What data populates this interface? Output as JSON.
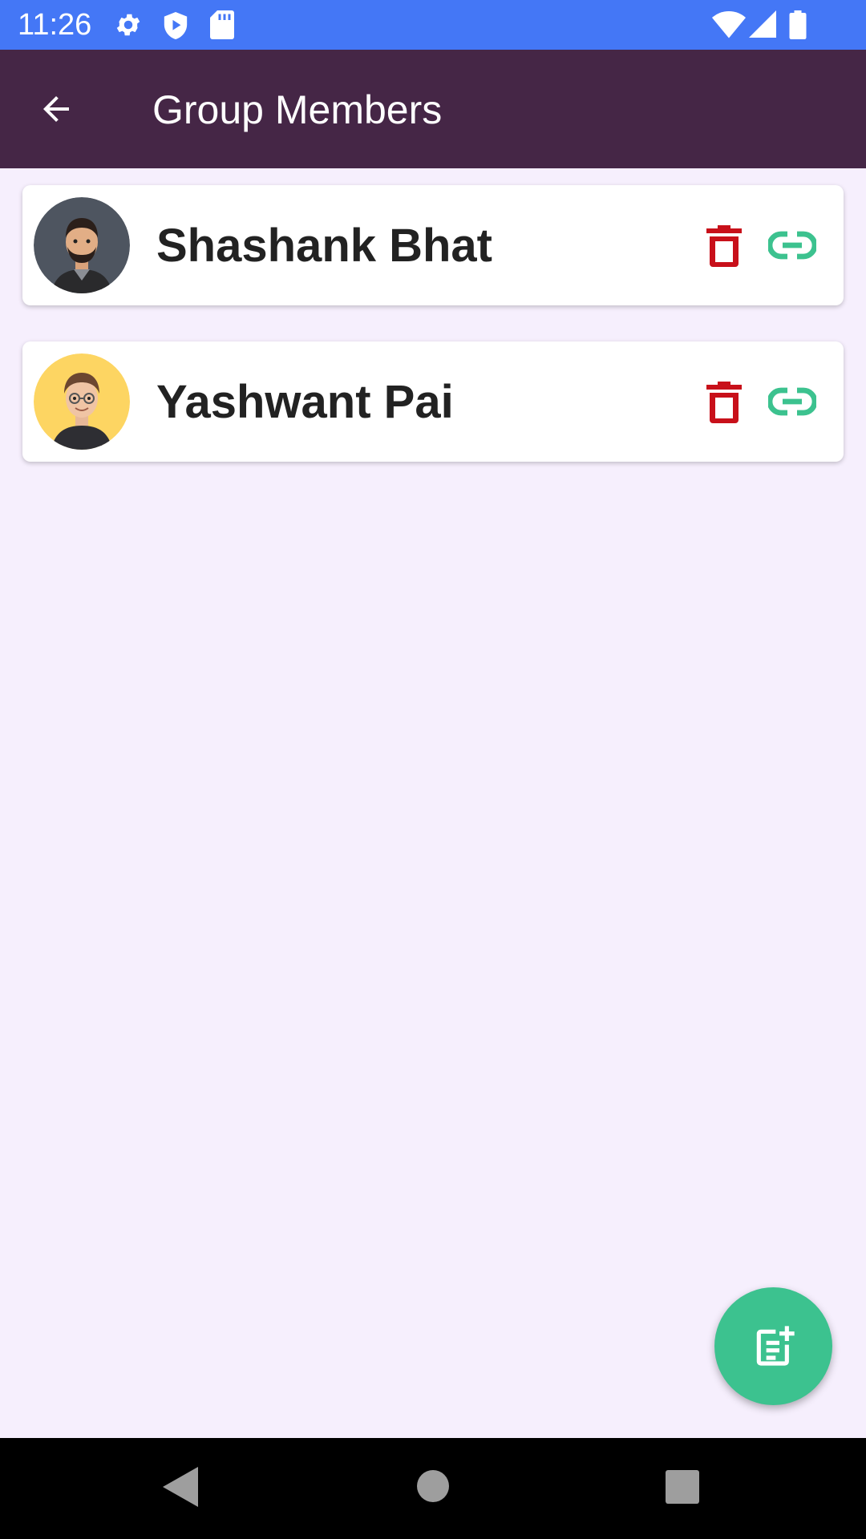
{
  "status_bar": {
    "time": "11:26",
    "icons": [
      "settings-icon",
      "shield-play-icon",
      "sd-card-icon",
      "wifi-icon",
      "signal-icon",
      "battery-icon"
    ]
  },
  "app_bar": {
    "title": "Group Members",
    "back_icon": "arrow-back-icon"
  },
  "members": [
    {
      "name": "Shashank Bhat",
      "avatar_bg": "#4E5560"
    },
    {
      "name": "Yashwant Pai",
      "avatar_bg": "#FDD562"
    }
  ],
  "actions": {
    "delete_icon": "trash-icon",
    "delete_color": "#C8101A",
    "link_icon": "link-icon",
    "link_color": "#3CC28F"
  },
  "fab": {
    "icon": "note-add-icon",
    "color": "#3CC28F"
  },
  "nav_bar": [
    "back-triangle-icon",
    "home-circle-icon",
    "recents-square-icon"
  ],
  "colors": {
    "status_bar": "#4477F6",
    "app_bar": "#452646",
    "background": "#F6EFFD"
  }
}
